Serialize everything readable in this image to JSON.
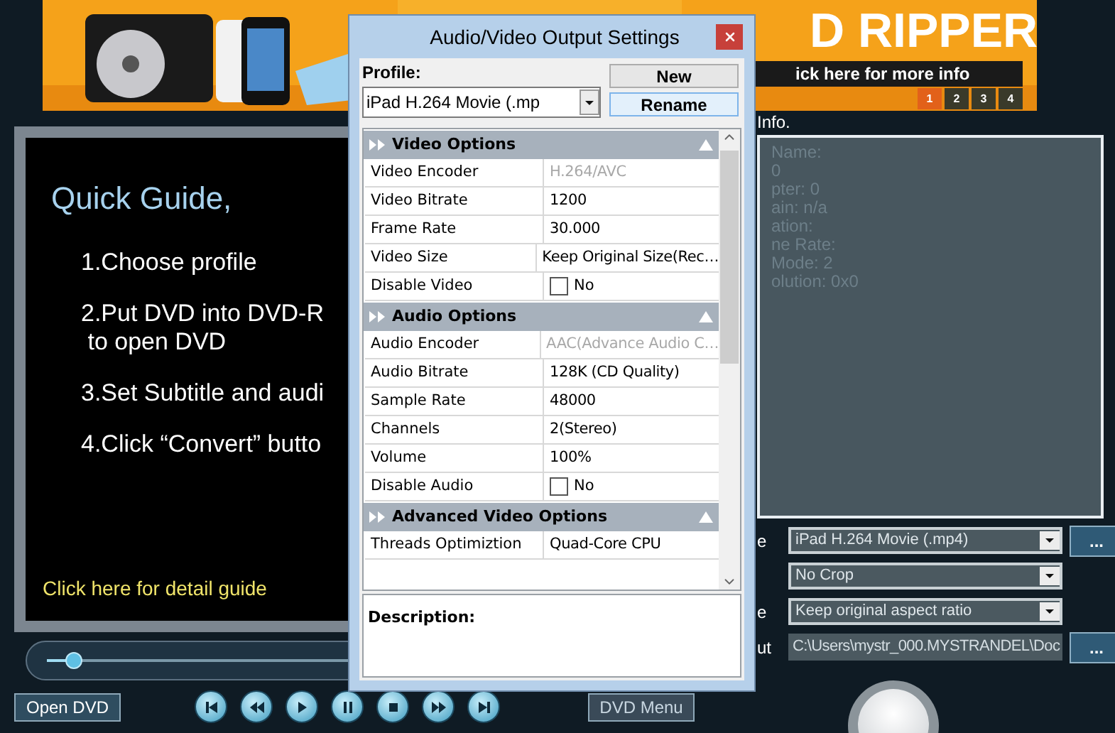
{
  "banner": {
    "headline": "D RIPPER",
    "link": "ick here for more info",
    "pages": [
      {
        "label": "1",
        "selected": true
      },
      {
        "label": "2",
        "selected": false
      },
      {
        "label": "3",
        "selected": false
      },
      {
        "label": "4",
        "selected": false
      }
    ]
  },
  "guide": {
    "title": "Quick Guide,",
    "steps": [
      "1.Choose profile",
      "2.Put DVD into DVD-R\n to open DVD",
      "3.Set Subtitle and audi",
      "4.Click “Convert” butto"
    ],
    "link": "Click here for detail guide"
  },
  "player": {
    "level": 0.04,
    "open_button": "Open DVD",
    "menu_button": "DVD Menu"
  },
  "info": {
    "label": "Info.",
    "lines": [
      "Name:",
      "0",
      "pter: 0",
      "ain: n/a",
      "ation:",
      "ne Rate:",
      "Mode: 2",
      "olution: 0x0"
    ]
  },
  "settings": [
    {
      "label": "e",
      "value": "iPad H.264 Movie (.mp4)",
      "kind": "select",
      "browse": "..."
    },
    {
      "value": "No Crop",
      "kind": "select"
    },
    {
      "label": "e",
      "value": "Keep original aspect ratio",
      "kind": "select"
    },
    {
      "label": "ut",
      "value": "C:\\Users\\mystr_000.MYSTRANDEL\\Doc",
      "kind": "path",
      "browse": "..."
    }
  ],
  "dialog": {
    "title": "Audio/Video Output Settings",
    "profile_label": "Profile:",
    "profile_value": "iPad H.264 Movie (.mp",
    "buttons": [
      {
        "label": "New",
        "selected": false
      },
      {
        "label": "Rename",
        "selected": true
      }
    ],
    "groups": [
      {
        "title": "Video Options",
        "expanded": true,
        "rows": [
          {
            "label": "Video Encoder",
            "value": "H.264/AVC",
            "kind": "text",
            "disabled": true
          },
          {
            "label": "Video Bitrate",
            "value": "1200",
            "kind": "text",
            "disabled": false
          },
          {
            "label": "Frame Rate",
            "value": "30.000",
            "kind": "text",
            "disabled": false
          },
          {
            "label": "Video Size",
            "value": "Keep Original Size(Rec…",
            "kind": "text",
            "disabled": false
          },
          {
            "label": "Disable Video",
            "value": "No",
            "kind": "checkbox",
            "checked": false
          }
        ]
      },
      {
        "title": "Audio Options",
        "expanded": true,
        "rows": [
          {
            "label": "Audio Encoder",
            "value": "AAC(Advance Audio C…",
            "kind": "text",
            "disabled": true
          },
          {
            "label": "Audio Bitrate",
            "value": "128K (CD Quality)",
            "kind": "text",
            "disabled": false
          },
          {
            "label": "Sample Rate",
            "value": "48000",
            "kind": "text",
            "disabled": false
          },
          {
            "label": "Channels",
            "value": "2(Stereo)",
            "kind": "text",
            "disabled": false
          },
          {
            "label": "Volume",
            "value": "100%",
            "kind": "text",
            "disabled": false
          },
          {
            "label": "Disable Audio",
            "value": "No",
            "kind": "checkbox",
            "checked": false
          }
        ]
      },
      {
        "title": "Advanced Video Options",
        "expanded": true,
        "rows": [
          {
            "label": "Threads Optimiztion",
            "value": "Quad-Core CPU",
            "kind": "text",
            "disabled": false
          }
        ]
      }
    ],
    "description_label": "Description:"
  }
}
